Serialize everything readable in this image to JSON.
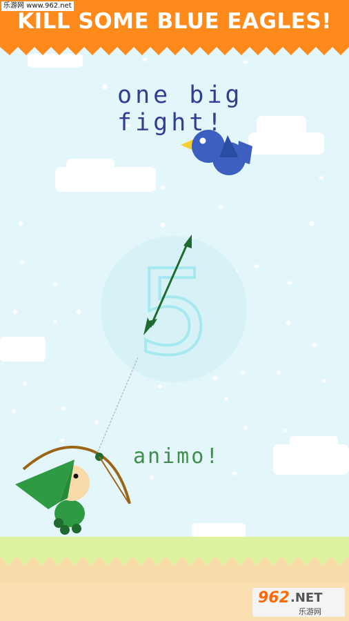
{
  "header": {
    "title": "KILL SOME BLUE EAGLES!"
  },
  "watermark_top": "乐游网 www.962.net",
  "watermark_bottom": {
    "number": "962",
    "suffix": ".NET",
    "chinese": "乐游网"
  },
  "messages": {
    "top": "one big fight!",
    "bottom": "animo!"
  },
  "countdown": {
    "value": "5"
  },
  "colors": {
    "sky": "#e3f6f9",
    "banner": "#ff8a1c",
    "grass": "#dcf29f",
    "sand": "#f8dba9",
    "bird": "#3d5fbf",
    "arrow": "#1f6a2e",
    "archer_hat": "#2f9a44"
  },
  "icons": {
    "enemy": "blue-bird-icon",
    "projectile": "arrow-icon",
    "player": "archer-icon"
  }
}
